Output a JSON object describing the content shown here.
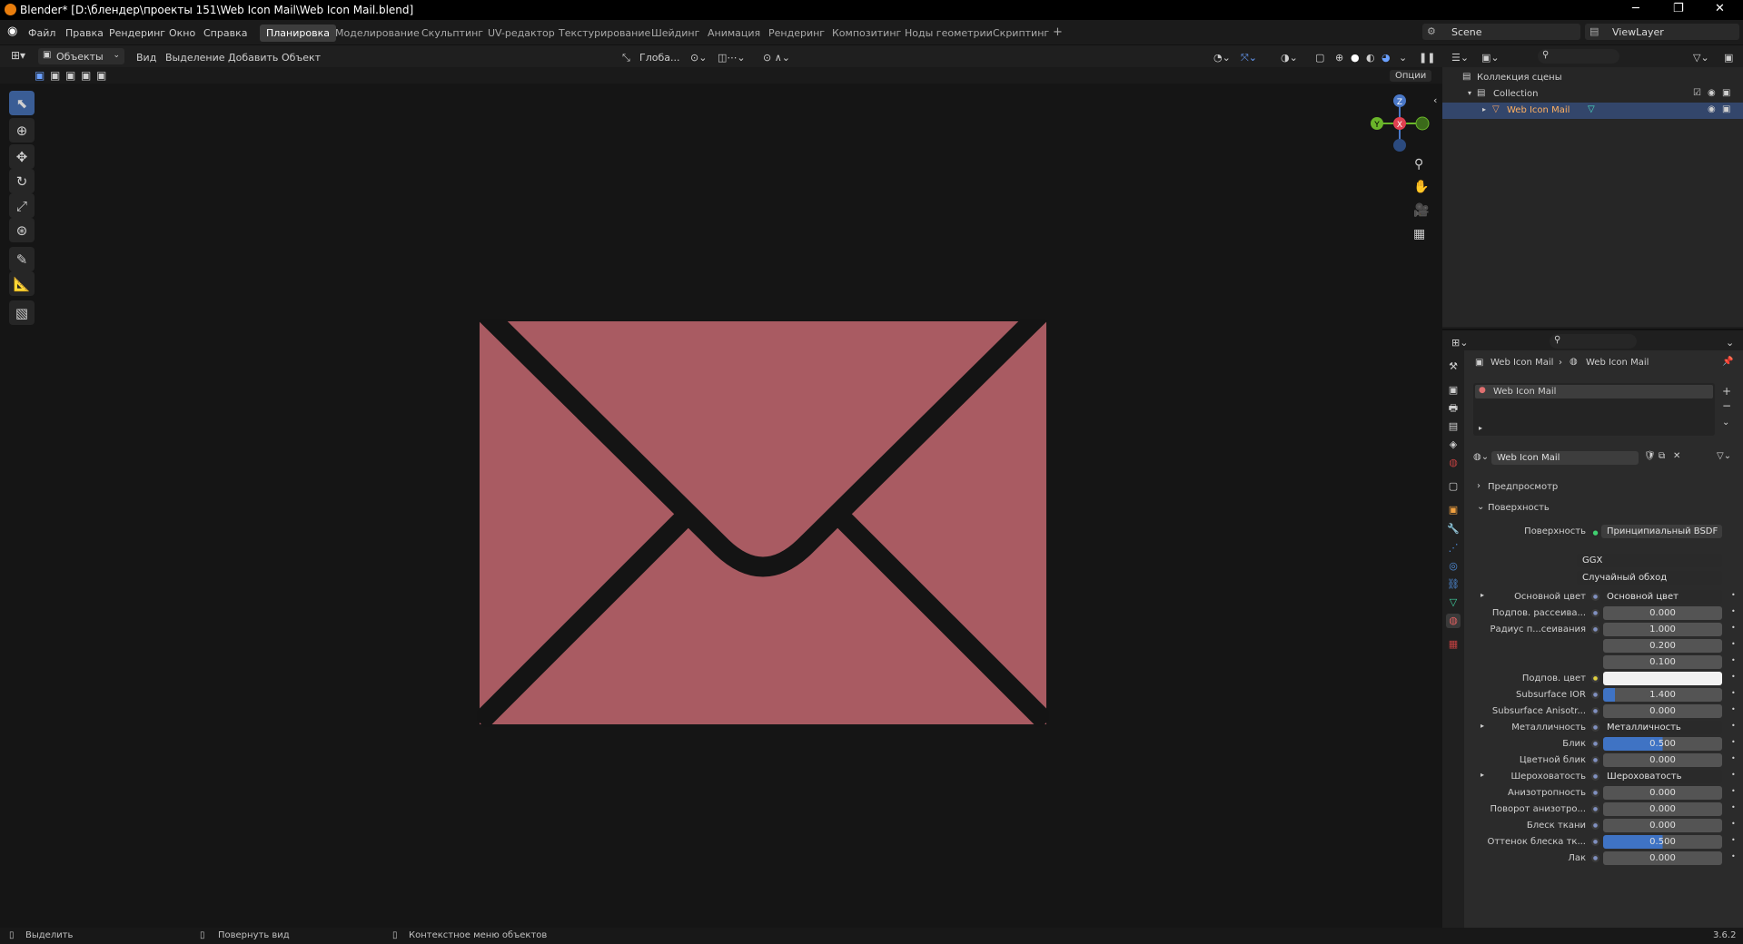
{
  "titlebar": {
    "title": "Blender* [D:\\блендер\\проекты 151\\Web Icon Mail\\Web Icon Mail.blend]",
    "minimize": "─",
    "maximize": "❐",
    "close": "✕"
  },
  "menu": {
    "file": "Файл",
    "edit": "Правка",
    "render": "Рендеринг",
    "window": "Окно",
    "help": "Справка"
  },
  "workspaces": [
    "Планировка",
    "Моделирование",
    "Скульптинг",
    "UV-редактор",
    "Текстурирование",
    "Шейдинг",
    "Анимация",
    "Рендеринг",
    "Композитинг",
    "Ноды геометрии",
    "Скриптинг",
    "+"
  ],
  "scene": {
    "label": "Scene",
    "viewlayer": "ViewLayer"
  },
  "viewport_header": {
    "mode": "Объекты",
    "view": "Вид",
    "select": "Выделение",
    "add": "Добавить",
    "object": "Объект",
    "orientation": "Глоба...",
    "options": "Опции"
  },
  "gizmo": {
    "z": "Z",
    "y": "Y",
    "x": "X"
  },
  "envelope": {
    "fill": "#a95b62",
    "stroke": "#141414"
  },
  "outliner": {
    "scene_collection": "Коллекция сцены",
    "collection": "Collection",
    "object": "Web Icon Mail"
  },
  "properties": {
    "breadcrumb_object": "Web Icon Mail",
    "breadcrumb_material": "Web Icon Mail",
    "slot": "Web Icon Mail",
    "material_name": "Web Icon Mail",
    "preview": "Предпросмотр",
    "surface_section": "Поверхность",
    "surface_label": "Поверхность",
    "surface_value": "Принципиальный BSDF",
    "distribution": "GGX",
    "subsurface_method": "Случайный обход",
    "rows": [
      {
        "label": "Основной цвет",
        "value": "Основной цвет",
        "kind": "link"
      },
      {
        "label": "Подпов. рассеива...",
        "value": "0.000",
        "kind": "num"
      },
      {
        "label": "Радиус п...сеивания",
        "value": "1.000",
        "kind": "num"
      },
      {
        "label": "",
        "value": "0.200",
        "kind": "num"
      },
      {
        "label": "",
        "value": "0.100",
        "kind": "num"
      },
      {
        "label": "Подпов. цвет",
        "value": "",
        "kind": "color"
      },
      {
        "label": "Subsurface IOR",
        "value": "1.400",
        "kind": "num",
        "fill": 0.1
      },
      {
        "label": "Subsurface Anisotr...",
        "value": "0.000",
        "kind": "num"
      },
      {
        "label": "Металличность",
        "value": "Металличность",
        "kind": "link"
      },
      {
        "label": "Блик",
        "value": "0.500",
        "kind": "num",
        "fill": 0.5
      },
      {
        "label": "Цветной блик",
        "value": "0.000",
        "kind": "num"
      },
      {
        "label": "Шероховатость",
        "value": "Шероховатость",
        "kind": "link"
      },
      {
        "label": "Анизотропность",
        "value": "0.000",
        "kind": "num"
      },
      {
        "label": "Поворот анизотро...",
        "value": "0.000",
        "kind": "num"
      },
      {
        "label": "Блеск ткани",
        "value": "0.000",
        "kind": "num"
      },
      {
        "label": "Оттенок блеска тк...",
        "value": "0.500",
        "kind": "num",
        "fill": 0.5
      },
      {
        "label": "Лак",
        "value": "0.000",
        "kind": "num"
      }
    ]
  },
  "status": {
    "select": "Выделить",
    "rotate": "Повернуть вид",
    "context": "Контекстное меню объектов",
    "version": "3.6.2"
  }
}
